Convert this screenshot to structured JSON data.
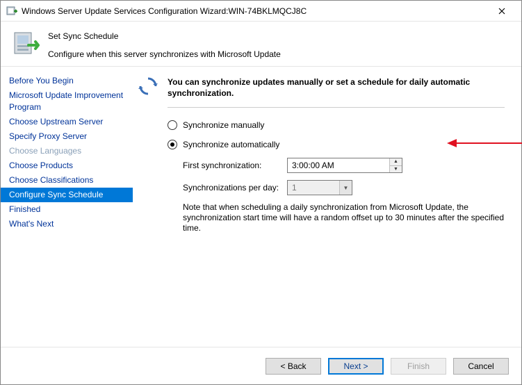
{
  "window": {
    "title": "Windows Server Update Services Configuration Wizard:WIN-74BKLMQCJ8C"
  },
  "header": {
    "title": "Set Sync Schedule",
    "subtitle": "Configure when this server synchronizes with Microsoft Update"
  },
  "nav": {
    "items": [
      {
        "label": "Before You Begin",
        "state": "link"
      },
      {
        "label": "Microsoft Update Improvement Program",
        "state": "link"
      },
      {
        "label": "Choose Upstream Server",
        "state": "link"
      },
      {
        "label": "Specify Proxy Server",
        "state": "link"
      },
      {
        "label": "Choose Languages",
        "state": "disabled"
      },
      {
        "label": "Choose Products",
        "state": "link"
      },
      {
        "label": "Choose Classifications",
        "state": "link"
      },
      {
        "label": "Configure Sync Schedule",
        "state": "active"
      },
      {
        "label": "Finished",
        "state": "link"
      },
      {
        "label": "What's Next",
        "state": "link"
      }
    ]
  },
  "content": {
    "intro": "You can synchronize updates manually or set a schedule for daily automatic synchronization.",
    "radio_manual": "Synchronize manually",
    "radio_auto": "Synchronize automatically",
    "selected": "auto",
    "first_sync_label": "First synchronization:",
    "first_sync_value": "3:00:00 AM",
    "per_day_label": "Synchronizations per day:",
    "per_day_value": "1",
    "note": "Note that when scheduling a daily synchronization from Microsoft Update, the synchronization start time will have a random offset up to 30 minutes after the specified time."
  },
  "footer": {
    "back": "< Back",
    "next": "Next >",
    "finish": "Finish",
    "cancel": "Cancel"
  }
}
